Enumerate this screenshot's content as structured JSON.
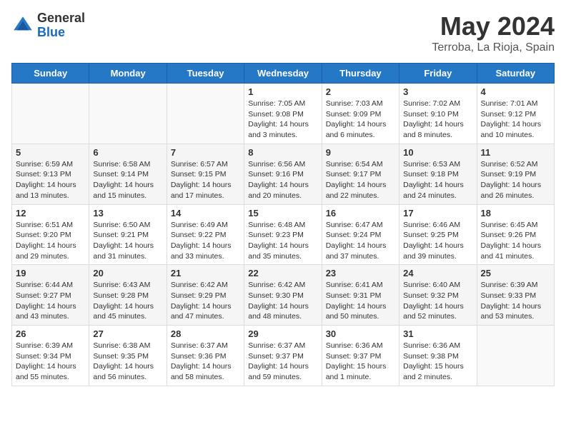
{
  "header": {
    "logo_general": "General",
    "logo_blue": "Blue",
    "month_year": "May 2024",
    "location": "Terroba, La Rioja, Spain"
  },
  "days_of_week": [
    "Sunday",
    "Monday",
    "Tuesday",
    "Wednesday",
    "Thursday",
    "Friday",
    "Saturday"
  ],
  "weeks": [
    [
      {
        "day": "",
        "info": ""
      },
      {
        "day": "",
        "info": ""
      },
      {
        "day": "",
        "info": ""
      },
      {
        "day": "1",
        "info": "Sunrise: 7:05 AM\nSunset: 9:08 PM\nDaylight: 14 hours\nand 3 minutes."
      },
      {
        "day": "2",
        "info": "Sunrise: 7:03 AM\nSunset: 9:09 PM\nDaylight: 14 hours\nand 6 minutes."
      },
      {
        "day": "3",
        "info": "Sunrise: 7:02 AM\nSunset: 9:10 PM\nDaylight: 14 hours\nand 8 minutes."
      },
      {
        "day": "4",
        "info": "Sunrise: 7:01 AM\nSunset: 9:12 PM\nDaylight: 14 hours\nand 10 minutes."
      }
    ],
    [
      {
        "day": "5",
        "info": "Sunrise: 6:59 AM\nSunset: 9:13 PM\nDaylight: 14 hours\nand 13 minutes."
      },
      {
        "day": "6",
        "info": "Sunrise: 6:58 AM\nSunset: 9:14 PM\nDaylight: 14 hours\nand 15 minutes."
      },
      {
        "day": "7",
        "info": "Sunrise: 6:57 AM\nSunset: 9:15 PM\nDaylight: 14 hours\nand 17 minutes."
      },
      {
        "day": "8",
        "info": "Sunrise: 6:56 AM\nSunset: 9:16 PM\nDaylight: 14 hours\nand 20 minutes."
      },
      {
        "day": "9",
        "info": "Sunrise: 6:54 AM\nSunset: 9:17 PM\nDaylight: 14 hours\nand 22 minutes."
      },
      {
        "day": "10",
        "info": "Sunrise: 6:53 AM\nSunset: 9:18 PM\nDaylight: 14 hours\nand 24 minutes."
      },
      {
        "day": "11",
        "info": "Sunrise: 6:52 AM\nSunset: 9:19 PM\nDaylight: 14 hours\nand 26 minutes."
      }
    ],
    [
      {
        "day": "12",
        "info": "Sunrise: 6:51 AM\nSunset: 9:20 PM\nDaylight: 14 hours\nand 29 minutes."
      },
      {
        "day": "13",
        "info": "Sunrise: 6:50 AM\nSunset: 9:21 PM\nDaylight: 14 hours\nand 31 minutes."
      },
      {
        "day": "14",
        "info": "Sunrise: 6:49 AM\nSunset: 9:22 PM\nDaylight: 14 hours\nand 33 minutes."
      },
      {
        "day": "15",
        "info": "Sunrise: 6:48 AM\nSunset: 9:23 PM\nDaylight: 14 hours\nand 35 minutes."
      },
      {
        "day": "16",
        "info": "Sunrise: 6:47 AM\nSunset: 9:24 PM\nDaylight: 14 hours\nand 37 minutes."
      },
      {
        "day": "17",
        "info": "Sunrise: 6:46 AM\nSunset: 9:25 PM\nDaylight: 14 hours\nand 39 minutes."
      },
      {
        "day": "18",
        "info": "Sunrise: 6:45 AM\nSunset: 9:26 PM\nDaylight: 14 hours\nand 41 minutes."
      }
    ],
    [
      {
        "day": "19",
        "info": "Sunrise: 6:44 AM\nSunset: 9:27 PM\nDaylight: 14 hours\nand 43 minutes."
      },
      {
        "day": "20",
        "info": "Sunrise: 6:43 AM\nSunset: 9:28 PM\nDaylight: 14 hours\nand 45 minutes."
      },
      {
        "day": "21",
        "info": "Sunrise: 6:42 AM\nSunset: 9:29 PM\nDaylight: 14 hours\nand 47 minutes."
      },
      {
        "day": "22",
        "info": "Sunrise: 6:42 AM\nSunset: 9:30 PM\nDaylight: 14 hours\nand 48 minutes."
      },
      {
        "day": "23",
        "info": "Sunrise: 6:41 AM\nSunset: 9:31 PM\nDaylight: 14 hours\nand 50 minutes."
      },
      {
        "day": "24",
        "info": "Sunrise: 6:40 AM\nSunset: 9:32 PM\nDaylight: 14 hours\nand 52 minutes."
      },
      {
        "day": "25",
        "info": "Sunrise: 6:39 AM\nSunset: 9:33 PM\nDaylight: 14 hours\nand 53 minutes."
      }
    ],
    [
      {
        "day": "26",
        "info": "Sunrise: 6:39 AM\nSunset: 9:34 PM\nDaylight: 14 hours\nand 55 minutes."
      },
      {
        "day": "27",
        "info": "Sunrise: 6:38 AM\nSunset: 9:35 PM\nDaylight: 14 hours\nand 56 minutes."
      },
      {
        "day": "28",
        "info": "Sunrise: 6:37 AM\nSunset: 9:36 PM\nDaylight: 14 hours\nand 58 minutes."
      },
      {
        "day": "29",
        "info": "Sunrise: 6:37 AM\nSunset: 9:37 PM\nDaylight: 14 hours\nand 59 minutes."
      },
      {
        "day": "30",
        "info": "Sunrise: 6:36 AM\nSunset: 9:37 PM\nDaylight: 15 hours\nand 1 minute."
      },
      {
        "day": "31",
        "info": "Sunrise: 6:36 AM\nSunset: 9:38 PM\nDaylight: 15 hours\nand 2 minutes."
      },
      {
        "day": "",
        "info": ""
      }
    ]
  ]
}
